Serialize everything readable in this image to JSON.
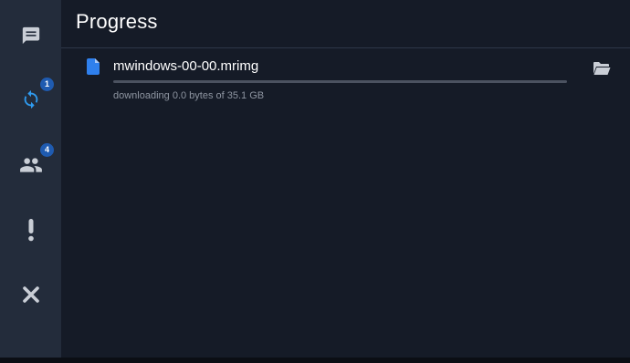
{
  "header": {
    "title": "Progress"
  },
  "sidebar": {
    "items": [
      {
        "name": "chat",
        "icon": "chat-icon"
      },
      {
        "name": "sync",
        "icon": "sync-icon",
        "badge": "1",
        "active": true
      },
      {
        "name": "users",
        "icon": "users-icon",
        "badge": "4"
      },
      {
        "name": "alert",
        "icon": "exclamation-icon"
      },
      {
        "name": "close",
        "icon": "close-icon"
      }
    ]
  },
  "transfers": [
    {
      "file_name": "mwindows-00-00.mrimg",
      "progress_fraction": 0.0,
      "status": "downloading 0.0 bytes of 35.1 GB"
    }
  ],
  "colors": {
    "accent": "#2f9bf0",
    "badge": "#1f5bb0",
    "sidebar_bg": "#232c3b",
    "main_bg": "#151b27"
  }
}
